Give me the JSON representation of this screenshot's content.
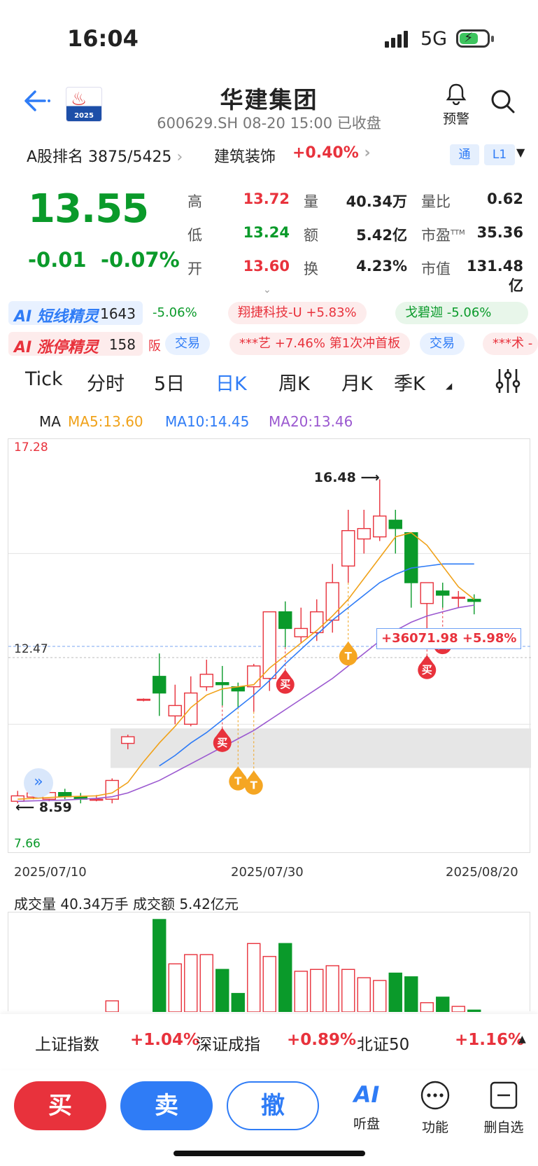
{
  "status": {
    "time": "16:04",
    "network": "5G"
  },
  "header": {
    "title": "华建集团",
    "subtitle": "600629.SH 08-20 15:00 已收盘",
    "logo_year": "2025",
    "alert_label": "预警"
  },
  "rank": {
    "label": "A股排名 3875/5425",
    "industry": "建筑装饰",
    "industry_change": "+0.40%",
    "tag1": "通",
    "tag2": "L1"
  },
  "quote": {
    "price": "13.55",
    "change": "-0.01",
    "change_pct": "-0.07%",
    "high_label": "高",
    "high": "13.72",
    "low_label": "低",
    "low": "13.24",
    "open_label": "开",
    "open": "13.60",
    "vol_label": "量",
    "vol": "40.34万",
    "amt_label": "额",
    "amt": "5.42亿",
    "turn_label": "换",
    "turn": "4.23%",
    "vr_label": "量比",
    "vr": "0.62",
    "pe_label": "市盈",
    "pe_sup": "TTM",
    "pe": "35.36",
    "mcap_label": "市值",
    "mcap": "131.48亿"
  },
  "ai1": {
    "title": "短线精灵",
    "count": "1643",
    "items": [
      "-5.06%",
      "翔捷科技-U +5.83%",
      "戈碧迦  -5.06%"
    ]
  },
  "ai2": {
    "title": "涨停精灵",
    "count": "158",
    "cut": "阪",
    "trade": "交易",
    "item": "***艺 +7.46% 第1次冲首板",
    "trade2": "交易",
    "cut2": "***术 -"
  },
  "tabs": [
    "Tick",
    "分时",
    "5日",
    "日K",
    "周K",
    "月K",
    "季K"
  ],
  "active_tab": "日K",
  "ma_legend": {
    "ma": "MA",
    "ma5": "MA5:13.60",
    "ma10": "MA10:14.45",
    "ma20": "MA20:13.46"
  },
  "colors": {
    "up": "#e8323c",
    "down": "#0a9a2a",
    "ma5": "#f0a21a",
    "ma10": "#2f7cf6",
    "ma20": "#9b59d0",
    "accent": "#2f7cf6"
  },
  "chart_data": {
    "type": "candlestick",
    "y_max_label": "17.28",
    "y_min_label": "7.66",
    "ylim": [
      7.66,
      17.28
    ],
    "ref_price_label": "12.47",
    "ref_price": 12.47,
    "high_annotation": "16.48",
    "low_annotation": "8.59",
    "profit_label": "+36071.98 +5.98%",
    "dates": [
      "2025/07/10",
      "2025/07/30",
      "2025/08/20"
    ],
    "candles": [
      [
        8.75,
        8.88,
        8.7,
        9.0
      ],
      [
        8.85,
        8.95,
        8.8,
        9.0
      ],
      [
        8.8,
        8.96,
        8.75,
        9.0
      ],
      [
        8.96,
        8.86,
        8.8,
        9.05
      ],
      [
        8.85,
        8.8,
        8.7,
        8.95
      ],
      [
        8.8,
        8.8,
        8.75,
        8.9
      ],
      [
        8.8,
        9.25,
        8.7,
        9.3
      ],
      [
        10.14,
        10.3,
        10.0,
        10.35
      ],
      [
        11.2,
        11.2,
        11.15,
        11.22
      ],
      [
        11.75,
        11.35,
        10.8,
        12.3
      ],
      [
        10.8,
        11.05,
        10.6,
        11.55
      ],
      [
        10.6,
        11.35,
        10.55,
        11.75
      ],
      [
        11.5,
        11.8,
        11.4,
        12.15
      ],
      [
        11.6,
        11.55,
        11.05,
        12.0
      ],
      [
        11.5,
        11.4,
        11.0,
        11.6
      ],
      [
        11.5,
        12.0,
        10.9,
        12.05
      ],
      [
        11.7,
        13.3,
        11.4,
        13.3
      ],
      [
        13.3,
        12.9,
        12.45,
        13.55
      ],
      [
        12.7,
        12.9,
        12.55,
        13.4
      ],
      [
        12.8,
        13.3,
        12.6,
        13.6
      ],
      [
        13.1,
        14.0,
        12.8,
        14.45
      ],
      [
        14.4,
        15.25,
        14.0,
        15.75
      ],
      [
        15.05,
        15.3,
        14.7,
        15.75
      ],
      [
        15.1,
        15.6,
        15.0,
        16.48
      ],
      [
        15.5,
        15.3,
        14.7,
        15.75
      ],
      [
        15.2,
        14.0,
        13.4,
        15.2
      ],
      [
        13.5,
        14.0,
        12.8,
        14.0
      ],
      [
        13.8,
        13.7,
        13.4,
        14.0
      ],
      [
        13.65,
        13.65,
        13.4,
        13.8
      ],
      [
        13.6,
        13.55,
        13.24,
        13.72
      ]
    ],
    "ma5": [
      8.8,
      8.82,
      8.84,
      8.86,
      8.87,
      8.88,
      8.95,
      9.2,
      9.7,
      10.15,
      10.55,
      11.0,
      11.3,
      11.45,
      11.5,
      11.55,
      11.95,
      12.25,
      12.55,
      12.85,
      13.2,
      13.6,
      14.1,
      14.6,
      15.1,
      15.2,
      14.9,
      14.4,
      13.9,
      13.6
    ],
    "ma10": [
      null,
      null,
      null,
      null,
      null,
      null,
      null,
      null,
      null,
      9.6,
      9.85,
      10.15,
      10.4,
      10.7,
      11.0,
      11.3,
      11.65,
      12.05,
      12.4,
      12.75,
      13.1,
      13.4,
      13.7,
      14.0,
      14.2,
      14.35,
      14.4,
      14.45,
      14.45,
      14.45
    ],
    "ma20": [
      8.75,
      8.76,
      8.77,
      8.78,
      8.8,
      8.82,
      8.86,
      8.95,
      9.1,
      9.25,
      9.45,
      9.65,
      9.85,
      10.05,
      10.25,
      10.45,
      10.7,
      10.95,
      11.2,
      11.45,
      11.7,
      12.0,
      12.3,
      12.6,
      12.85,
      13.05,
      13.2,
      13.3,
      13.4,
      13.46
    ],
    "signals": [
      {
        "label": "买",
        "index": 13,
        "type": "buy"
      },
      {
        "label": "T",
        "index": 14,
        "type": "t"
      },
      {
        "label": "T",
        "index": 15,
        "type": "t"
      },
      {
        "label": "买",
        "index": 17,
        "type": "buy"
      },
      {
        "label": "T",
        "index": 21,
        "type": "t"
      },
      {
        "label": "买",
        "index": 26,
        "type": "buy"
      },
      {
        "label": "买",
        "index": 27,
        "type": "buy"
      }
    ],
    "volume_title": "成交量 40.34万手  成交额 5.42亿元",
    "volume_values": [
      0,
      0,
      0,
      0,
      0,
      0,
      0.12,
      0,
      0,
      1.0,
      0.52,
      0.62,
      0.62,
      0.46,
      0.2,
      0.74,
      0.6,
      0.74,
      0.44,
      0.46,
      0.5,
      0.46,
      0.37,
      0.34,
      0.42,
      0.38,
      0.1,
      0.16,
      0.06,
      0.02
    ]
  },
  "indices": [
    {
      "name": "上证指数",
      "value": "+1.04%"
    },
    {
      "name": "深证成指",
      "value": "+0.89%"
    },
    {
      "name": "北证50",
      "value": "+1.16%"
    }
  ],
  "bottom": {
    "buy": "买",
    "sell": "卖",
    "cancel": "撤",
    "ai_logo": "AI",
    "ai_label": "听盘",
    "func_label": "功能",
    "del_label": "删自选"
  }
}
